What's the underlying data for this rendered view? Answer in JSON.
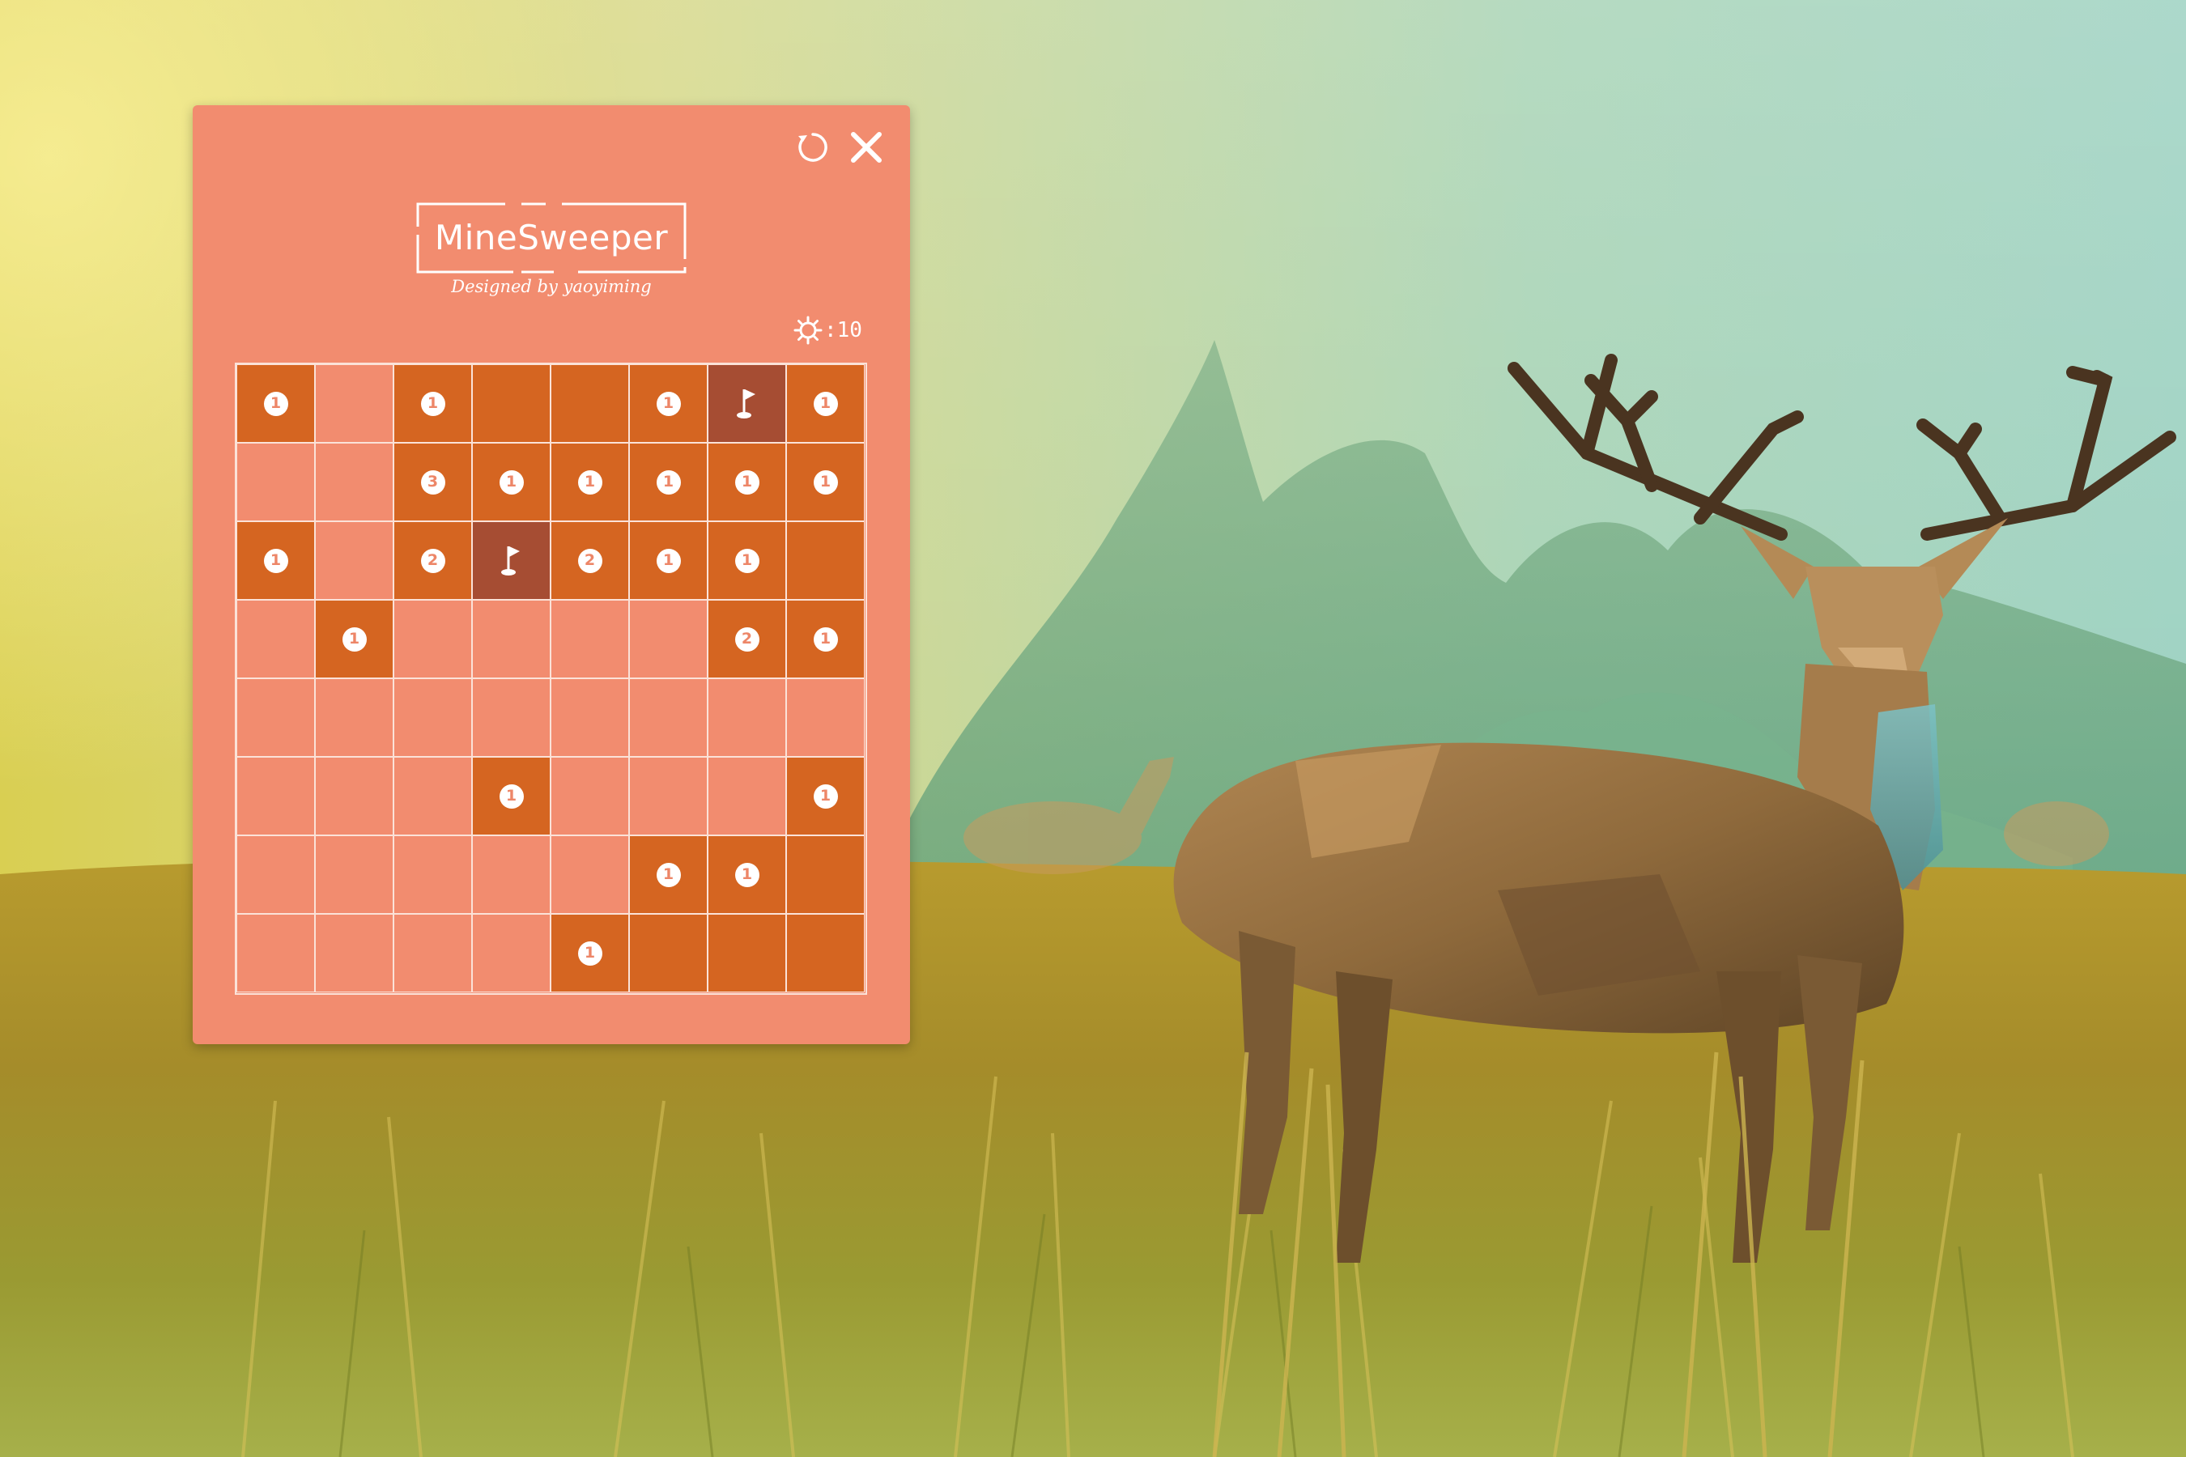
{
  "game": {
    "title": "MineSweeper",
    "subtitle": "Designed by yaoyiming",
    "mine_counter": ":10",
    "controls": {
      "restart_icon": "restart-icon",
      "close_icon": "close-icon",
      "mine_icon": "mine-icon",
      "flag_icon": "flag-icon"
    },
    "colors": {
      "window_bg": "#f28c6f",
      "hidden_cell": "#d56521",
      "flagged_cell": "#a64d33",
      "grid_line": "#fbe2d8",
      "text": "#ffffff"
    },
    "board": {
      "rows": 8,
      "cols": 8,
      "cells": [
        [
          {
            "s": "h",
            "v": "1"
          },
          {
            "s": "r",
            "v": ""
          },
          {
            "s": "h",
            "v": "1"
          },
          {
            "s": "h",
            "v": ""
          },
          {
            "s": "h",
            "v": ""
          },
          {
            "s": "h",
            "v": "1"
          },
          {
            "s": "f",
            "v": ""
          },
          {
            "s": "h",
            "v": "1"
          }
        ],
        [
          {
            "s": "r",
            "v": ""
          },
          {
            "s": "r",
            "v": ""
          },
          {
            "s": "h",
            "v": "3"
          },
          {
            "s": "h",
            "v": "1"
          },
          {
            "s": "h",
            "v": "1"
          },
          {
            "s": "h",
            "v": "1"
          },
          {
            "s": "h",
            "v": "1"
          },
          {
            "s": "h",
            "v": "1"
          }
        ],
        [
          {
            "s": "h",
            "v": "1"
          },
          {
            "s": "r",
            "v": ""
          },
          {
            "s": "h",
            "v": "2"
          },
          {
            "s": "f",
            "v": ""
          },
          {
            "s": "h",
            "v": "2"
          },
          {
            "s": "h",
            "v": "1"
          },
          {
            "s": "h",
            "v": "1"
          },
          {
            "s": "h",
            "v": ""
          }
        ],
        [
          {
            "s": "r",
            "v": ""
          },
          {
            "s": "h",
            "v": "1"
          },
          {
            "s": "r",
            "v": ""
          },
          {
            "s": "r",
            "v": ""
          },
          {
            "s": "r",
            "v": ""
          },
          {
            "s": "r",
            "v": ""
          },
          {
            "s": "h",
            "v": "2"
          },
          {
            "s": "h",
            "v": "1"
          }
        ],
        [
          {
            "s": "r",
            "v": ""
          },
          {
            "s": "r",
            "v": ""
          },
          {
            "s": "r",
            "v": ""
          },
          {
            "s": "r",
            "v": ""
          },
          {
            "s": "r",
            "v": ""
          },
          {
            "s": "r",
            "v": ""
          },
          {
            "s": "r",
            "v": ""
          },
          {
            "s": "r",
            "v": ""
          }
        ],
        [
          {
            "s": "r",
            "v": ""
          },
          {
            "s": "r",
            "v": ""
          },
          {
            "s": "r",
            "v": ""
          },
          {
            "s": "h",
            "v": "1"
          },
          {
            "s": "r",
            "v": ""
          },
          {
            "s": "r",
            "v": ""
          },
          {
            "s": "r",
            "v": ""
          },
          {
            "s": "h",
            "v": "1"
          }
        ],
        [
          {
            "s": "r",
            "v": ""
          },
          {
            "s": "r",
            "v": ""
          },
          {
            "s": "r",
            "v": ""
          },
          {
            "s": "r",
            "v": ""
          },
          {
            "s": "r",
            "v": ""
          },
          {
            "s": "h",
            "v": "1"
          },
          {
            "s": "h",
            "v": "1"
          },
          {
            "s": "h",
            "v": ""
          }
        ],
        [
          {
            "s": "r",
            "v": ""
          },
          {
            "s": "r",
            "v": ""
          },
          {
            "s": "r",
            "v": ""
          },
          {
            "s": "r",
            "v": ""
          },
          {
            "s": "h",
            "v": "1"
          },
          {
            "s": "h",
            "v": ""
          },
          {
            "s": "h",
            "v": ""
          },
          {
            "s": "h",
            "v": ""
          }
        ]
      ]
    }
  },
  "wallpaper": {
    "description_icon": "deer-meadow-wallpaper"
  }
}
